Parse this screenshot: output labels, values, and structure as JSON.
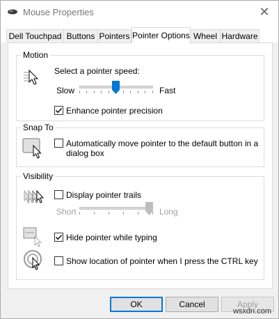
{
  "window": {
    "title": "Mouse Properties",
    "close_glyph": "✕"
  },
  "tabs": [
    {
      "label": "Dell Touchpad"
    },
    {
      "label": "Buttons"
    },
    {
      "label": "Pointers"
    },
    {
      "label": "Pointer Options",
      "active": true
    },
    {
      "label": "Wheel"
    },
    {
      "label": "Hardware"
    }
  ],
  "motion": {
    "group_label": "Motion",
    "speed_label": "Select a pointer speed:",
    "slow_label": "Slow",
    "fast_label": "Fast",
    "speed_value": 0.5,
    "enhance_label": "Enhance pointer precision",
    "enhance_checked": true
  },
  "snap_to": {
    "group_label": "Snap To",
    "auto_label_line1": "Automatically move pointer to the default button in a",
    "auto_label_line2": "dialog box",
    "auto_checked": false
  },
  "visibility": {
    "group_label": "Visibility",
    "trails_label": "Display pointer trails",
    "trails_checked": false,
    "short_label": "Short",
    "long_label": "Long",
    "trails_length": 1.0,
    "hide_label": "Hide pointer while typing",
    "hide_checked": true,
    "show_location_label": "Show location of pointer when I press the CTRL key",
    "show_location_checked": false
  },
  "buttons": {
    "ok": "OK",
    "cancel": "Cancel",
    "apply": "Apply"
  },
  "watermark": "wsxdn.com",
  "colors": {
    "accent": "#0078d7",
    "panel": "#ffffff",
    "chrome": "#f0f0f0"
  }
}
